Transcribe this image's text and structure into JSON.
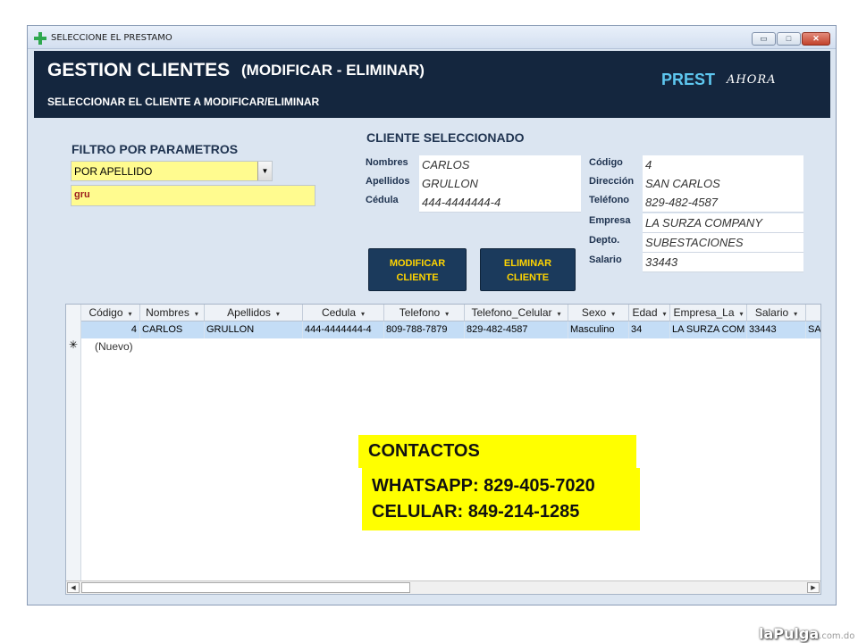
{
  "window": {
    "title": "SELECCIONE EL PRESTAMO",
    "min": "▭",
    "max": "□",
    "close": "✕"
  },
  "banner": {
    "title": "GESTION CLIENTES",
    "subtitle": "(MODIFICAR - ELIMINAR)",
    "instruction": "SELECCIONAR EL CLIENTE A MODIFICAR/ELIMINAR",
    "brand_main": "PREST",
    "brand_sub": "AHORA"
  },
  "filter": {
    "title": "FILTRO POR PARAMETROS",
    "selected": "POR APELLIDO",
    "text": "gru"
  },
  "selected_client": {
    "title": "CLIENTE SELECCIONADO",
    "nombres_label": "Nombres",
    "nombres": "CARLOS",
    "apellidos_label": "Apellidos",
    "apellidos": "GRULLON",
    "cedula_label": "Cédula",
    "cedula": "444-4444444-4",
    "codigo_label": "Código",
    "codigo": "4",
    "direccion_label": "Dirección",
    "direccion": "SAN CARLOS",
    "telefono_label": "Teléfono",
    "telefono": "829-482-4587",
    "empresa_label": "Empresa",
    "empresa": "LA SURZA COMPANY",
    "depto_label": "Depto.",
    "depto": "SUBESTACIONES",
    "salario_label": "Salario",
    "salario": "33443"
  },
  "buttons": {
    "modificar_1": "MODIFICAR",
    "modificar_2": "CLIENTE",
    "eliminar_1": "ELIMINAR",
    "eliminar_2": "CLIENTE"
  },
  "grid": {
    "headers": [
      "Código",
      "Nombres",
      "Apellidos",
      "Cedula",
      "Telefono",
      "Telefono_Celular",
      "Sexo",
      "Edad",
      "Empresa_La",
      "Salario"
    ],
    "drop": "▾",
    "row": [
      "4",
      "CARLOS",
      "GRULLON",
      "444-4444444-4",
      "809-788-7879",
      "829-482-4587",
      "Masculino",
      "34",
      "LA SURZA COM",
      "33443",
      "SA"
    ],
    "new_marker": "✳",
    "new_label": "(Nuevo)"
  },
  "contact": {
    "title": "CONTACTOS",
    "whatsapp": "WHATSAPP: 829-405-7020",
    "celular": "CELULAR: 849-214-1285"
  },
  "watermark": {
    "main": "laPulga",
    "domain": ".com.do"
  },
  "colors": {
    "banner": "#14263e",
    "accent": "#5ec7ef",
    "button": "#1b3a5c",
    "button_text": "#ffd400",
    "highlight": "#ffff00"
  }
}
